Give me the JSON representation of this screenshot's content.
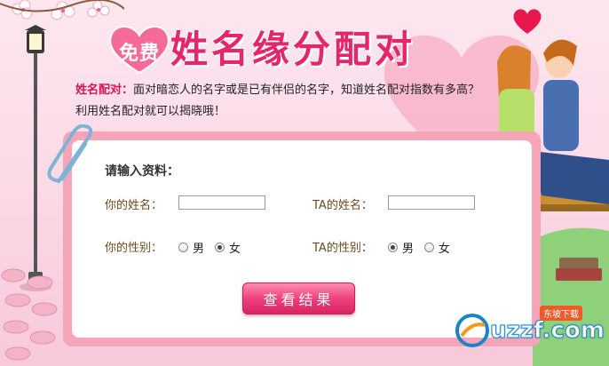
{
  "title": {
    "badge": "免费",
    "main": "姓名缘分配对"
  },
  "description": {
    "lead": "姓名配对：",
    "line1": "面对暗恋人的名字或是已有伴侣的名字，知道姓名配对指数有多高？",
    "line2": "利用姓名配对就可以揭晓哦！"
  },
  "form": {
    "heading": "请输入资料：",
    "your_name_label": "你的姓名：",
    "your_name_value": "",
    "ta_name_label": "TA的姓名：",
    "ta_name_value": "",
    "your_gender_label": "你的性别：",
    "your_gender_options": [
      "男",
      "女"
    ],
    "your_gender_selected": "女",
    "ta_gender_label": "TA的性别：",
    "ta_gender_options": [
      "男",
      "女"
    ],
    "ta_gender_selected": "男",
    "submit_label": "查看结果"
  },
  "watermark": {
    "text": "uzzf.com",
    "tag": "东坡下载"
  },
  "colors": {
    "accent": "#e6266a",
    "panel_border": "#f4a6b8",
    "button": "#f0417c"
  },
  "icons": [
    "heart-icon",
    "paperclip-icon",
    "street-lamp-icon",
    "flower-icon"
  ]
}
